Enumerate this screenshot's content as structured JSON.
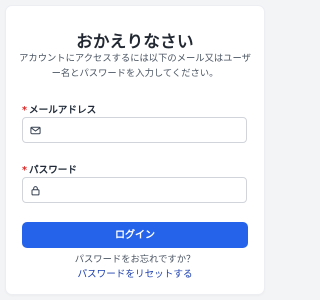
{
  "form": {
    "title": "おかえりなさい",
    "subtitle": "アカウントにアクセスするには以下のメール又はユーザー名とパスワードを入力してください。",
    "email": {
      "required_mark": "*",
      "label": "メールアドレス",
      "value": "",
      "placeholder": "",
      "icon": "mail-icon"
    },
    "password": {
      "required_mark": "*",
      "label": "パスワード",
      "value": "",
      "placeholder": "",
      "icon": "lock-icon"
    },
    "login_button": "ログイン",
    "forgot_text": "パスワードをお忘れですか？",
    "reset_link": "パスワードをリセットする"
  },
  "colors": {
    "primary": "#2563eb",
    "required": "#dc2626",
    "link": "#1e40af"
  }
}
